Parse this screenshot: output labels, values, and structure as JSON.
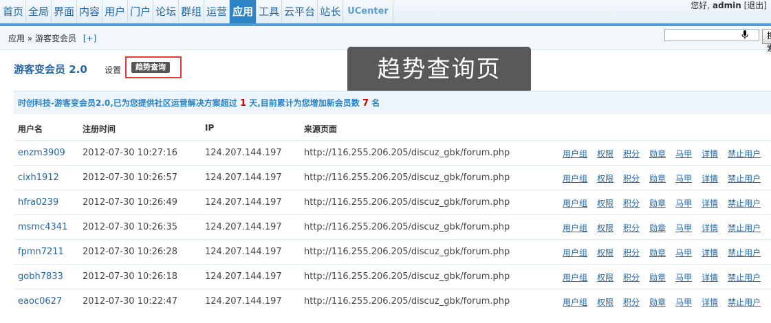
{
  "nav": {
    "items": [
      "首页",
      "全局",
      "界面",
      "内容",
      "用户",
      "门户",
      "论坛",
      "群组",
      "运营",
      "应用",
      "工具",
      "云平台",
      "站长",
      "UCenter"
    ],
    "active_index": 9,
    "greeting": "您好,",
    "username": "admin",
    "logout": "[退出]"
  },
  "breadcrumb": {
    "root": "应用",
    "sep": "»",
    "current": "游客变会员",
    "add": "[+]",
    "search_button": "搜索"
  },
  "plugin": {
    "title": "游客变会员 2.0",
    "settings": "设置",
    "trend_button": "趋势查询"
  },
  "caption": "趋势查询页",
  "info": {
    "prefix": "时创科技-游客变会员2.0,已为您提供社区运营解决方案超过",
    "days": "1",
    "middle": "天,目前累计为您增加新会员数",
    "count": "7",
    "suffix": "名"
  },
  "table": {
    "headers": [
      "用户名",
      "注册时间",
      "IP",
      "来源页面"
    ],
    "actions": [
      "用户组",
      "权限",
      "积分",
      "勋章",
      "马甲",
      "详情",
      "禁止用户"
    ],
    "rows": [
      {
        "user": "enzm3909",
        "time": "2012-07-30 10:27:16",
        "ip": "124.207.144.197",
        "url": "http://116.255.206.205/discuz_gbk/forum.php"
      },
      {
        "user": "cixh1912",
        "time": "2012-07-30 10:26:57",
        "ip": "124.207.144.197",
        "url": "http://116.255.206.205/discuz_gbk/forum.php"
      },
      {
        "user": "hfra0239",
        "time": "2012-07-30 10:26:49",
        "ip": "124.207.144.197",
        "url": "http://116.255.206.205/discuz_gbk/forum.php"
      },
      {
        "user": "msmc4341",
        "time": "2012-07-30 10:26:35",
        "ip": "124.207.144.197",
        "url": "http://116.255.206.205/discuz_gbk/forum.php"
      },
      {
        "user": "fpmn7211",
        "time": "2012-07-30 10:26:28",
        "ip": "124.207.144.197",
        "url": "http://116.255.206.205/discuz_gbk/forum.php"
      },
      {
        "user": "gobh7833",
        "time": "2012-07-30 10:26:18",
        "ip": "124.207.144.197",
        "url": "http://116.255.206.205/discuz_gbk/forum.php"
      },
      {
        "user": "eaoc0627",
        "time": "2012-07-30 10:22:47",
        "ip": "124.207.144.197",
        "url": "http://116.255.206.205/discuz_gbk/forum.php"
      }
    ]
  },
  "colors": {
    "nav_text": "#2366a8",
    "nav_active_bg": "#2f84c6",
    "info_text": "#2a82c4",
    "highlight_number": "#d10000",
    "annotation_border": "#e53935"
  },
  "icons": {
    "search_field": "microphone-icon"
  }
}
